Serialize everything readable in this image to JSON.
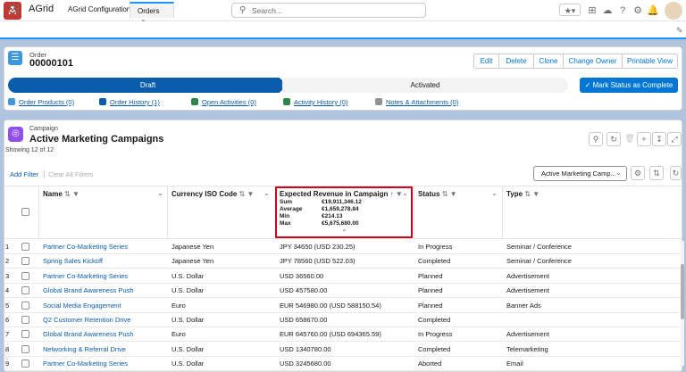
{
  "topbar": {
    "search_placeholder": "Search...",
    "logo_text": "A"
  },
  "nav": {
    "app_name": "AGrid",
    "tabs": [
      {
        "label": "AGrid Configuration"
      },
      {
        "label": "Orders"
      }
    ]
  },
  "order": {
    "object_label": "Order",
    "number": "00000101",
    "buttons": [
      "Edit",
      "Delete",
      "Clone",
      "Change Owner",
      "Printable View"
    ],
    "path": {
      "done": "Draft",
      "todo": "Activated"
    },
    "mark_status_label": "Mark Status as Complete",
    "related_links": [
      "Order Products (0)",
      "Order History (1)",
      "Open Activities (0)",
      "Activity History (0)",
      "Notes & Attachments (0)"
    ]
  },
  "campaign": {
    "object_label": "Campaign",
    "title": "Active Marketing Campaigns",
    "showing": "Showing 12 of 12",
    "add_filter": "Add Filter",
    "clear_filters": "Clear All Filters",
    "view_select": "Active Marketing Camp...",
    "columns": {
      "name": "Name",
      "currency": "Currency ISO Code",
      "revenue": "Expected Revenue in Campaign",
      "status": "Status",
      "type": "Type"
    },
    "summary": [
      {
        "label": "Sum",
        "value": "€19,911,346.12"
      },
      {
        "label": "Average",
        "value": "€1,659,278.84"
      },
      {
        "label": "Min",
        "value": "€214.13"
      },
      {
        "label": "Max",
        "value": "€5,675,680.00"
      }
    ],
    "rows": [
      {
        "n": "1",
        "name": "Partner Co-Marketing Series",
        "currency": "Japanese Yen",
        "revenue": "JPY 34650 (USD 230.25)",
        "status": "In Progress",
        "type": "Seminar / Conference"
      },
      {
        "n": "2",
        "name": "Spring Sales Kickoff",
        "currency": "Japanese Yen",
        "revenue": "JPY 78560 (USD 522.03)",
        "status": "Completed",
        "type": "Seminar / Conference"
      },
      {
        "n": "3",
        "name": "Partner Co-Marketing Series",
        "currency": "U.S. Dollar",
        "revenue": "USD 36560.00",
        "status": "Planned",
        "type": "Advertisement"
      },
      {
        "n": "4",
        "name": "Global Brand Awareness Push",
        "currency": "U.S. Dollar",
        "revenue": "USD 457580.00",
        "status": "Planned",
        "type": "Advertisement"
      },
      {
        "n": "5",
        "name": "Social Media Engagement",
        "currency": "Euro",
        "revenue": "EUR 546980.00 (USD 588150.54)",
        "status": "Planned",
        "type": "Banner Ads"
      },
      {
        "n": "6",
        "name": "Q2 Customer Retention Drive",
        "currency": "U.S. Dollar",
        "revenue": "USD 658670.00",
        "status": "Completed",
        "type": ""
      },
      {
        "n": "7",
        "name": "Global Brand Awareness Push",
        "currency": "Euro",
        "revenue": "EUR 645760.00 (USD 694365.59)",
        "status": "In Progress",
        "type": "Advertisement"
      },
      {
        "n": "8",
        "name": "Networking & Referral Drive",
        "currency": "U.S. Dollar",
        "revenue": "USD 1340780.00",
        "status": "Completed",
        "type": "Telemarketing"
      },
      {
        "n": "9",
        "name": "Partner Co-Marketing Series",
        "currency": "U.S. Dollar",
        "revenue": "USD 3245680.00",
        "status": "Aborted",
        "type": "Email"
      }
    ]
  },
  "colors": {
    "brand_blue": "#0176d3",
    "path_done": "#0b5cab",
    "highlight_border": "#d0021b",
    "campaign_icon": "#9050e9",
    "order_icon": "#3c97dd"
  }
}
